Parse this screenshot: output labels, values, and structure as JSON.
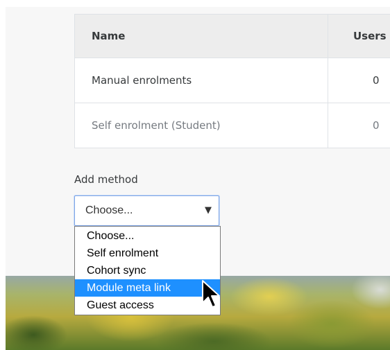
{
  "table": {
    "headers": {
      "name": "Name",
      "users": "Users"
    },
    "rows": [
      {
        "name": "Manual enrolments",
        "users": "0"
      },
      {
        "name": "Self enrolment (Student)",
        "users": "0"
      }
    ]
  },
  "add_method": {
    "label": "Add method",
    "selected": "Choose...",
    "options": [
      "Choose...",
      "Self enrolment",
      "Cohort sync",
      "Module meta link",
      "Guest access"
    ],
    "highlighted_option": "Module meta link"
  },
  "icons": {
    "select_arrow": "dropdown-arrow-icon",
    "cursor": "mouse-pointer-icon"
  },
  "colors": {
    "highlight": "#1e90ff",
    "header_bg": "#ededed",
    "select_border": "#7ea5e6"
  }
}
